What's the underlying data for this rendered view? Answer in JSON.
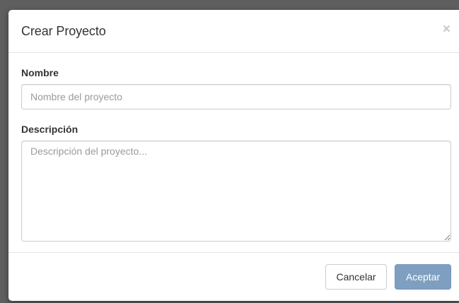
{
  "modal": {
    "title": "Crear Proyecto",
    "close_label": "×"
  },
  "form": {
    "name_label": "Nombre",
    "name_placeholder": "Nombre del proyecto",
    "name_value": "",
    "description_label": "Descripción",
    "description_placeholder": "Descripción del proyecto...",
    "description_value": ""
  },
  "footer": {
    "cancel_label": "Cancelar",
    "accept_label": "Aceptar"
  },
  "colors": {
    "accept_button": "#7f9fc0",
    "backdrop": "#5f5f5f",
    "title_text": "#333333"
  }
}
